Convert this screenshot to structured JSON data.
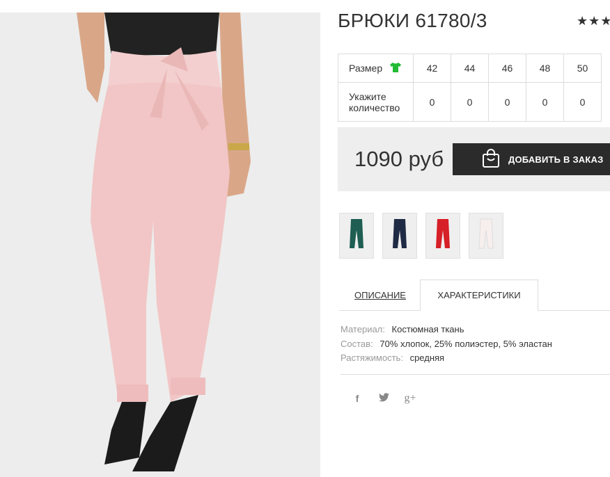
{
  "product": {
    "title": "БРЮКИ 61780/3",
    "rating_stars": "★★★",
    "image_alt": "pink trousers on model"
  },
  "sizes": {
    "size_label": "Размер",
    "qty_label": "Укажите количество",
    "values": [
      "42",
      "44",
      "46",
      "48",
      "50"
    ],
    "quantities": [
      "0",
      "0",
      "0",
      "0",
      "0"
    ]
  },
  "buy": {
    "price": "1090 руб",
    "add_button": "ДОБАВИТЬ В ЗАКАЗ"
  },
  "colors": {
    "thumb_colors": [
      "#1f5e52",
      "#1f2a44",
      "#d61f26",
      "#f3e6e6"
    ],
    "accent": "#22bb33",
    "button_bg": "#2b2b2b",
    "product_pink": "#f3c9c9"
  },
  "tabs": {
    "description": "ОПИСАНИЕ",
    "characteristics": "ХАРАКТЕРИСТИКИ"
  },
  "specs": [
    {
      "key": "Материал:",
      "value": "Костюмная ткань"
    },
    {
      "key": "Состав:",
      "value": "70% хлопок, 25% полиэстер, 5% эластан"
    },
    {
      "key": "Растяжимость:",
      "value": "средняя"
    }
  ],
  "social": {
    "icons": [
      "facebook-icon",
      "twitter-icon",
      "google-plus-icon"
    ],
    "facebook": "f",
    "google_plus": "g+"
  }
}
